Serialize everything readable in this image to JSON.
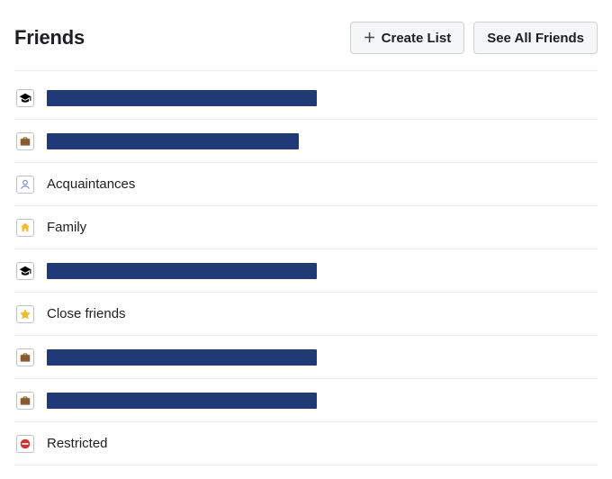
{
  "header": {
    "title": "Friends",
    "create_list_label": "Create List",
    "see_all_label": "See All Friends"
  },
  "lists": [
    {
      "icon": "graduation-cap",
      "redacted": true,
      "label": "",
      "redact_class": "w1"
    },
    {
      "icon": "briefcase",
      "redacted": true,
      "label": "",
      "redact_class": "w2"
    },
    {
      "icon": "person",
      "redacted": false,
      "label": "Acquaintances"
    },
    {
      "icon": "home",
      "redacted": false,
      "label": "Family"
    },
    {
      "icon": "graduation-cap",
      "redacted": true,
      "label": "",
      "redact_class": "w3"
    },
    {
      "icon": "star",
      "redacted": false,
      "label": "Close friends"
    },
    {
      "icon": "briefcase",
      "redacted": true,
      "label": "",
      "redact_class": "w4"
    },
    {
      "icon": "briefcase",
      "redacted": true,
      "label": "",
      "redact_class": "w5"
    },
    {
      "icon": "no-entry",
      "redacted": false,
      "label": "Restricted"
    }
  ]
}
